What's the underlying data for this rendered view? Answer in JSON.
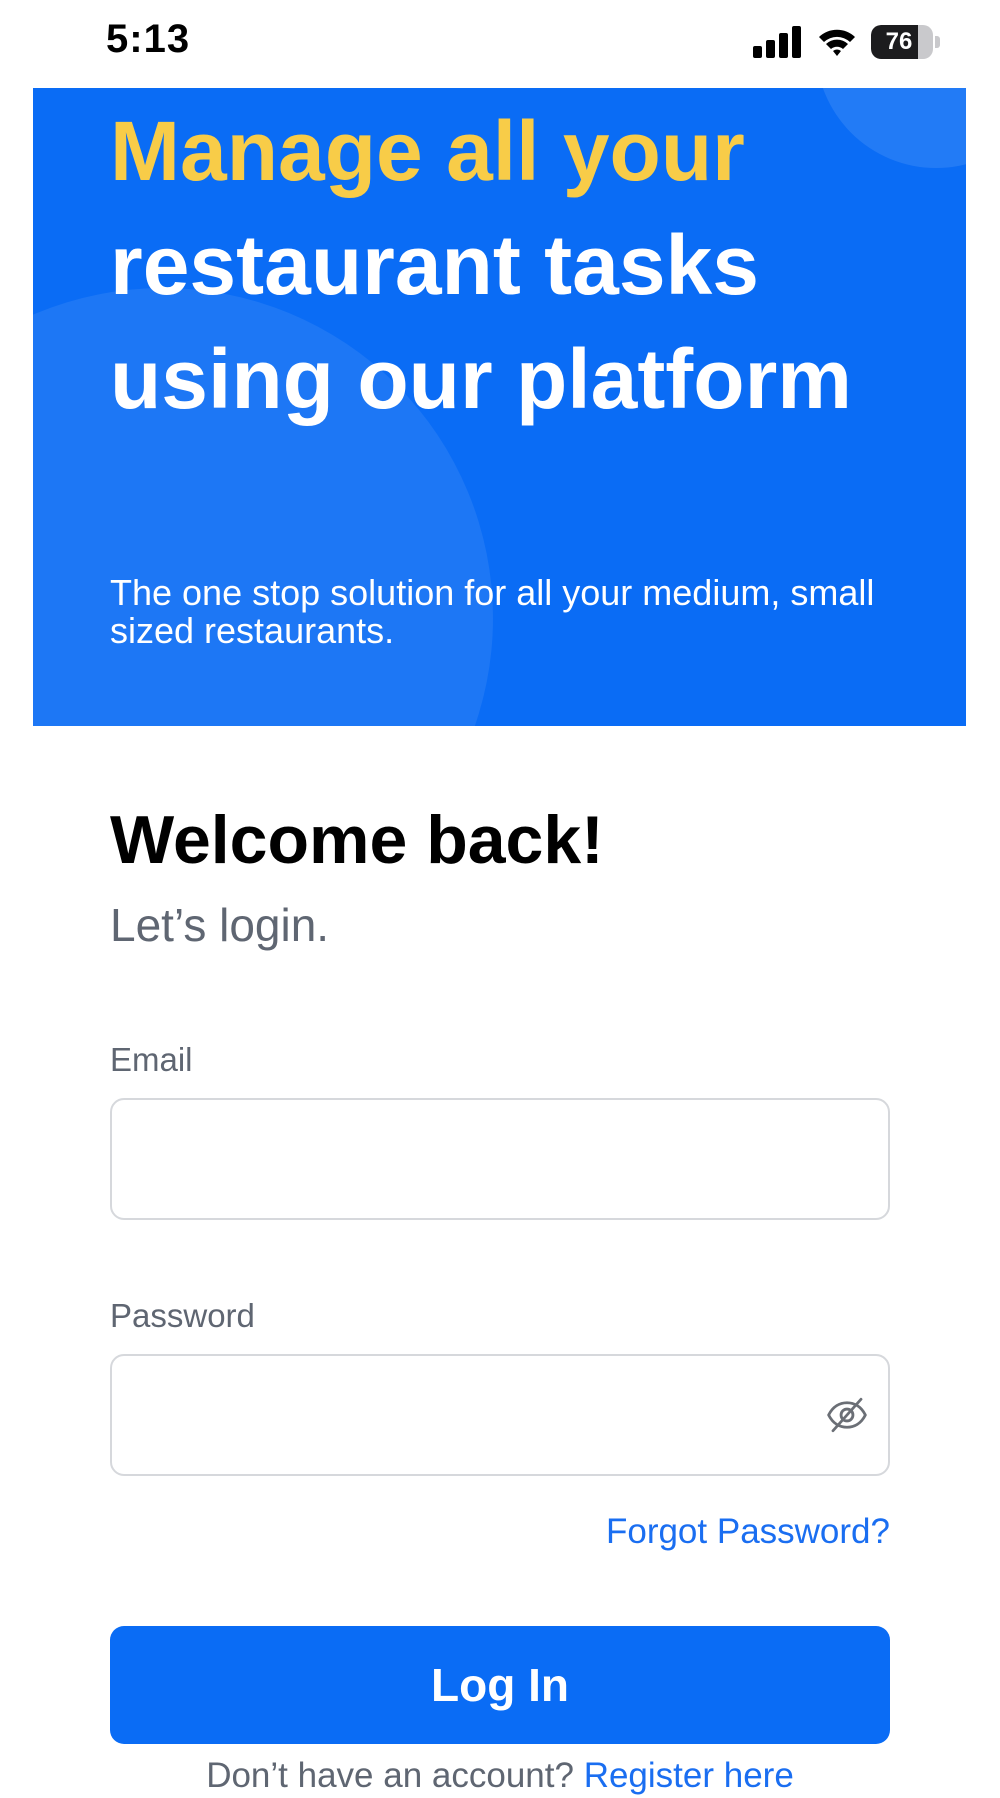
{
  "status_bar": {
    "time": "5:13",
    "battery_level": "76",
    "battery_percent": 76,
    "icons": [
      "signal-icon",
      "wifi-icon",
      "battery-icon"
    ]
  },
  "hero": {
    "headline_highlight": "Manage all your",
    "headline_rest": "restaurant tasks using our platform",
    "subtitle": "The one stop solution for all your medium, small sized restaurants.",
    "colors": {
      "background": "#0a6cf5",
      "highlight": "#f8cc48",
      "text": "#ffffff"
    }
  },
  "login": {
    "title": "Welcome back!",
    "subtitle": "Let’s login.",
    "email": {
      "label": "Email",
      "value": "",
      "placeholder": ""
    },
    "password": {
      "label": "Password",
      "value": "",
      "placeholder": "",
      "toggle_icon": "eye-off-icon"
    },
    "forgot_password": "Forgot Password?",
    "login_button": "Log In",
    "register_prompt": "Don’t have an account?",
    "register_link": "Register here"
  },
  "colors": {
    "primary": "#0a6cf5",
    "link": "#1a6ef1",
    "muted_text": "#5f6672",
    "input_border": "#d6d8dc"
  }
}
